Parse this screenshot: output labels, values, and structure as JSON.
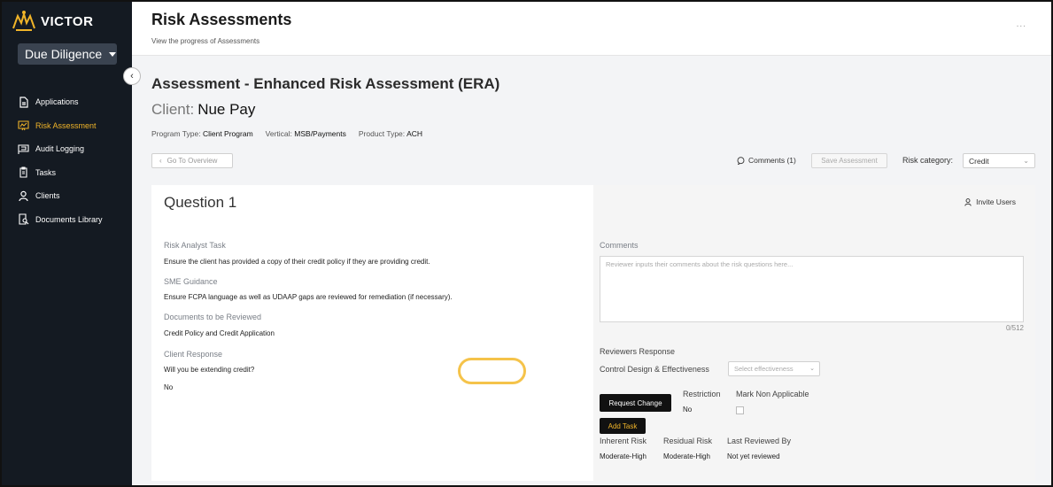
{
  "app": {
    "brand": "VICTOR",
    "module": "Due Diligence"
  },
  "sidebar": {
    "items": [
      {
        "label": "Applications",
        "icon": "document-icon",
        "active": false
      },
      {
        "label": "Risk Assessment",
        "icon": "chart-board-icon",
        "active": true
      },
      {
        "label": "Audit Logging",
        "icon": "flag-board-icon",
        "active": false
      },
      {
        "label": "Tasks",
        "icon": "clipboard-icon",
        "active": false
      },
      {
        "label": "Clients",
        "icon": "user-icon",
        "active": false
      },
      {
        "label": "Documents Library",
        "icon": "document-search-icon",
        "active": false
      }
    ]
  },
  "header": {
    "title": "Risk Assessments",
    "subtitle": "View the progress of Assessments",
    "more": "..."
  },
  "assessment": {
    "title": "Assessment - Enhanced Risk Assessment (ERA)",
    "client_label": "Client:",
    "client_name": "Nue Pay",
    "program_type_label": "Program Type:",
    "program_type": "Client Program",
    "vertical_label": "Vertical:",
    "vertical": "MSB/Payments",
    "product_type_label": "Product Type:",
    "product_type": "ACH"
  },
  "toolbar": {
    "overview": "Go To Overview",
    "comments": "Comments (1)",
    "save": "Save Assessment",
    "risk_category_label": "Risk category:",
    "risk_category_value": "Credit"
  },
  "question": {
    "title": "Question 1",
    "analyst_task_label": "Risk Analyst Task",
    "analyst_task": "Ensure the client has provided a copy of their credit policy if they are providing credit.",
    "sme_label": "SME Guidance",
    "sme": "Ensure FCPA language as well as UDAAP gaps are reviewed for remediation (if necessary).",
    "docs_label": "Documents to be Reviewed",
    "docs": "Credit Policy and Credit Application",
    "client_response_label": "Client Response",
    "client_question": "Will you be extending credit?",
    "client_answer": "No"
  },
  "review": {
    "invite": "Invite Users",
    "comments_label": "Comments",
    "comments_placeholder": "Reviewer inputs their comments about the risk questions here...",
    "counter": "0/512",
    "reviewers_response": "Reviewers Response",
    "control_label": "Control Design & Effectiveness",
    "effectiveness_placeholder": "Select effectiveness",
    "request_change": "Request Change",
    "restriction_label": "Restriction",
    "restriction_value": "No",
    "mark_na_label": "Mark Non Applicable",
    "add_task": "Add Task",
    "inherent_label": "Inherent Risk",
    "inherent_value": "Moderate-High",
    "residual_label": "Residual Risk",
    "residual_value": "Moderate-High",
    "last_reviewed_label": "Last Reviewed By",
    "last_reviewed_value": "Not yet reviewed"
  },
  "colors": {
    "sidebar_bg": "#141a22",
    "accent": "#f0b429",
    "highlight": "#f5c34a"
  }
}
